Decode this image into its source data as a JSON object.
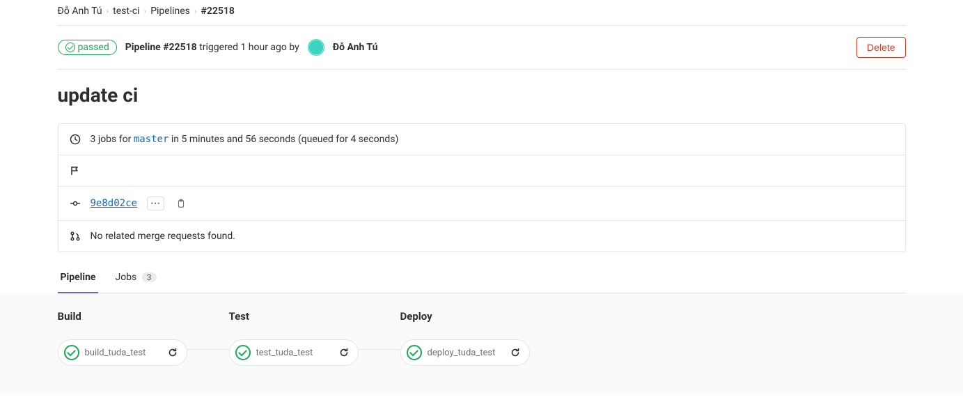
{
  "breadcrumb": {
    "user": "Đỗ Anh Tú",
    "project": "test-ci",
    "section": "Pipelines",
    "current": "#22518"
  },
  "status": {
    "label": "passed"
  },
  "header": {
    "pipeline_prefix": "Pipeline",
    "pipeline_id": "#22518",
    "triggered_text": "triggered 1 hour ago by",
    "author": "Đỗ Anh Tú",
    "delete_label": "Delete"
  },
  "commit_title": "update ci",
  "jobs_summary": {
    "prefix": "3 jobs for ",
    "branch": "master",
    "suffix": " in 5 minutes and 56 seconds (queued for 4 seconds)"
  },
  "commit": {
    "sha": "9e8d02ce",
    "dots": "⋯"
  },
  "mr_message": "No related merge requests found.",
  "tabs": {
    "pipeline": "Pipeline",
    "jobs": "Jobs",
    "jobs_count": "3"
  },
  "stages": [
    {
      "title": "Build",
      "job": "build_tuda_test"
    },
    {
      "title": "Test",
      "job": "test_tuda_test"
    },
    {
      "title": "Deploy",
      "job": "deploy_tuda_test"
    }
  ]
}
